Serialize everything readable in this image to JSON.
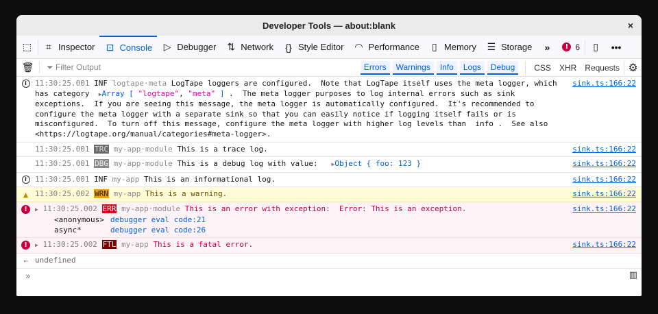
{
  "window": {
    "title": "Developer Tools — about:blank",
    "close": "×"
  },
  "tabs": [
    {
      "label": "Inspector",
      "icon": "inspector-icon"
    },
    {
      "label": "Console",
      "icon": "console-icon"
    },
    {
      "label": "Debugger",
      "icon": "debugger-icon"
    },
    {
      "label": "Network",
      "icon": "network-icon"
    },
    {
      "label": "Style Editor",
      "icon": "braces-icon"
    },
    {
      "label": "Performance",
      "icon": "gauge-icon"
    },
    {
      "label": "Memory",
      "icon": "chip-icon"
    },
    {
      "label": "Storage",
      "icon": "storage-icon"
    }
  ],
  "error_count": "6",
  "filter": {
    "placeholder": "Filter Output",
    "levels": [
      "Errors",
      "Warnings",
      "Info",
      "Logs",
      "Debug"
    ],
    "extra": [
      "CSS",
      "XHR",
      "Requests"
    ]
  },
  "messages": [
    {
      "ts": "11:30:25.001",
      "level": "INF",
      "cat": "logtape·meta",
      "text1": "LogTape loggers are configured.  Note that LogTape itself uses the meta logger, which has category  ",
      "arr": "Array [ ",
      "s1": "\"logtape\"",
      "comma": ", ",
      "s2": "\"meta\"",
      "arrend": " ]",
      "text2": " .  The meta logger purposes to log internal errors such as sink exceptions.  If you are seeing this message, the meta logger is automatically configured.  It's recommended to configure the meta logger with a separate sink so that you can easily notice if logging itself fails or is misconfigured.  To turn off this message, configure the meta logger with higher log levels than  info .  See also <https://logtape.org/manual/categories#meta-logger>.",
      "src": "sink.ts:166:22"
    },
    {
      "ts": "11:30:25.001",
      "level": "TRC",
      "cat": "my-app·module",
      "text": "This is a trace log.",
      "src": "sink.ts:166:22"
    },
    {
      "ts": "11:30:25.001",
      "level": "DBG",
      "cat": "my-app·module",
      "text": "This is a debug log with value:  ",
      "obj": "Object { foo: 123 }",
      "src": "sink.ts:166:22"
    },
    {
      "ts": "11:30:25.001",
      "level": "INF",
      "cat": "my-app",
      "text": "This is an informational log.",
      "src": "sink.ts:166:22"
    },
    {
      "ts": "11:30:25.002",
      "level": "WRN",
      "cat": "my-app",
      "text": "This is a warning.",
      "src": "sink.ts:166:22"
    },
    {
      "ts": "11:30:25.002",
      "level": "ERR",
      "cat": "my-app·module",
      "text": "This is an error with exception:  Error: This is an exception.",
      "stack": [
        {
          "fn": "<anonymous>",
          "loc": "debugger eval code:21"
        },
        {
          "fn": "async*",
          "loc": "debugger eval code:26"
        }
      ],
      "src": "sink.ts:166:22"
    },
    {
      "ts": "11:30:25.002",
      "level": "FTL",
      "cat": "my-app",
      "text": "This is a fatal error.",
      "src": "sink.ts:166:22"
    }
  ],
  "result": "undefined",
  "colors": {
    "accent": "#0061e0",
    "error": "#c50042",
    "warnBg": "#fffbd6",
    "errBg": "#fdf2f5"
  }
}
